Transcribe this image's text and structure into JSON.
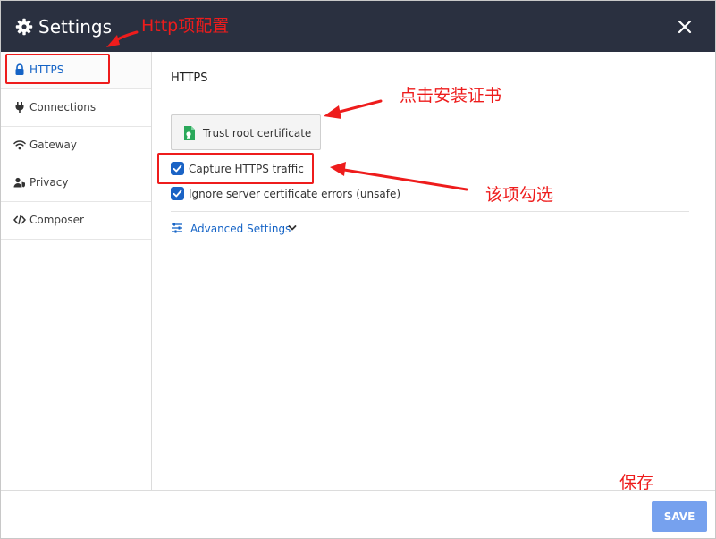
{
  "window": {
    "title": "Settings"
  },
  "sidebar": {
    "items": [
      {
        "label": "HTTPS",
        "icon": "lock-icon"
      },
      {
        "label": "Connections",
        "icon": "plug-icon"
      },
      {
        "label": "Gateway",
        "icon": "wifi-icon"
      },
      {
        "label": "Privacy",
        "icon": "user-shield-icon"
      },
      {
        "label": "Composer",
        "icon": "code-icon"
      }
    ]
  },
  "main": {
    "section_title": "HTTPS",
    "trust_button_label": "Trust root certificate",
    "capture_https_label": "Capture HTTPS traffic",
    "capture_https_checked": true,
    "ignore_errors_label": "Ignore server certificate errors (unsafe)",
    "ignore_errors_checked": true,
    "advanced_settings_label": "Advanced Settings"
  },
  "footer": {
    "save_label": "SAVE"
  },
  "annotations": {
    "http_config": "Http项配置",
    "install_cert": "点击安装证书",
    "check_this": "该项勾选",
    "save": "保存"
  },
  "colors": {
    "titlebar": "#2a3040",
    "accent": "#1463c6",
    "checkbox": "#1a63c5",
    "save_button": "#76a1ee",
    "annotation": "#ee1c1c",
    "cert_icon": "#2aa85a"
  }
}
